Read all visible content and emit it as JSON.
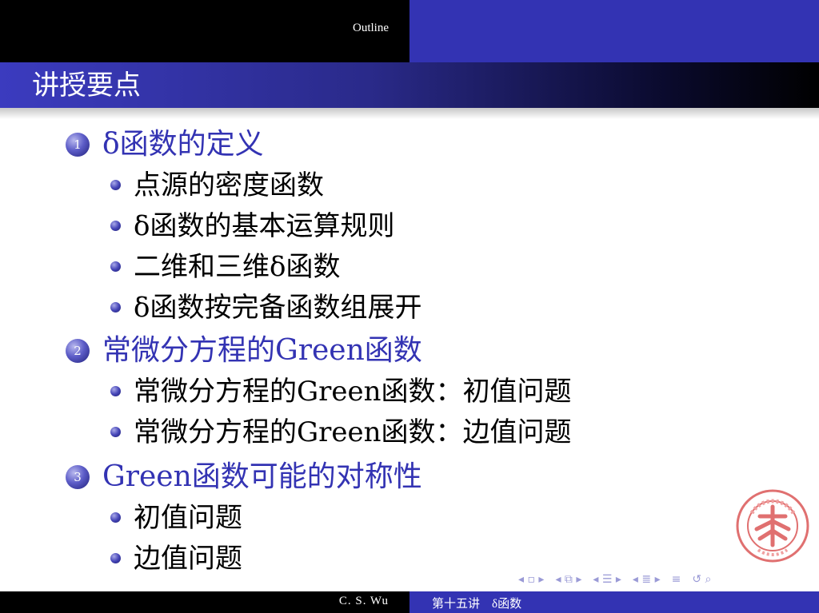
{
  "header": {
    "outline_label": "Outline"
  },
  "frame": {
    "title": "讲授要点"
  },
  "sections": [
    {
      "number": "1",
      "title": "δ函数的定义",
      "items": [
        "点源的密度函数",
        "δ函数的基本运算规则",
        "二维和三维δ函数",
        "δ函数按完备函数组展开"
      ]
    },
    {
      "number": "2",
      "title": "常微分方程的Green函数",
      "items": [
        "常微分方程的Green函数：初值问题",
        "常微分方程的Green函数：边值问题"
      ]
    },
    {
      "number": "3",
      "title": "Green函数可能的对称性",
      "items": [
        "初值问题",
        "边值问题"
      ]
    }
  ],
  "footer": {
    "author": "C. S. Wu",
    "lecture": "第十五讲　δ函数"
  },
  "colors": {
    "accent": "#3333b3",
    "bar_dark": "#000000",
    "seal": "#e07070"
  }
}
